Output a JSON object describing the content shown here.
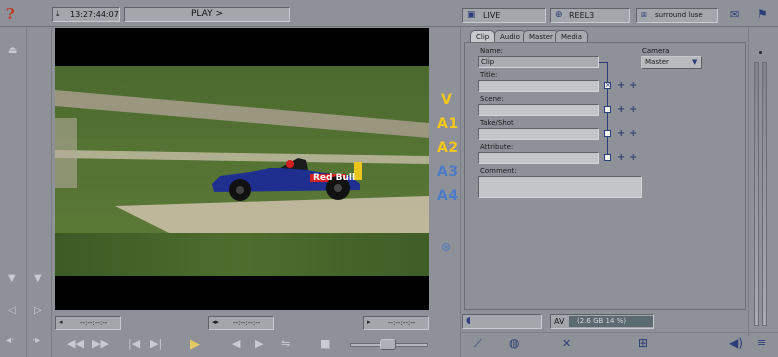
{
  "top_bar": {
    "timecode": "13:27:44:07",
    "status": "PLAY >",
    "source": "LIVE",
    "reel": "REEL3",
    "surround": "surround luse"
  },
  "channels": [
    "V",
    "A1",
    "A2",
    "A3",
    "A4"
  ],
  "transport": {
    "in_tc": "--:--:--:--",
    "duration_tc": "--:--:--:--",
    "out_tc": "--:--:--:--"
  },
  "tabs": [
    "Clip",
    "Audio",
    "Master",
    "Media"
  ],
  "form": {
    "name_label": "Name:",
    "name_value": "Clip",
    "title_label": "Title:",
    "scene_label": "Scene:",
    "take_label": "Take/Shot",
    "attribute_label": "Attribute:",
    "comment_label": "Comment:",
    "camera_label": "Camera",
    "camera_value": "Master"
  },
  "bottom_panel": {
    "av_label": "AV",
    "storage": "(2.6 GB 14 %)"
  },
  "icons": {
    "help": "question-mark-icon",
    "link": "link-icon",
    "play": "play-icon"
  },
  "colors": {
    "channel_active": "#f3c61b",
    "channel_inactive": "#4d7bc7",
    "help": "#c0392b"
  },
  "viewer": {
    "sponsor_text": "Red Bull"
  }
}
